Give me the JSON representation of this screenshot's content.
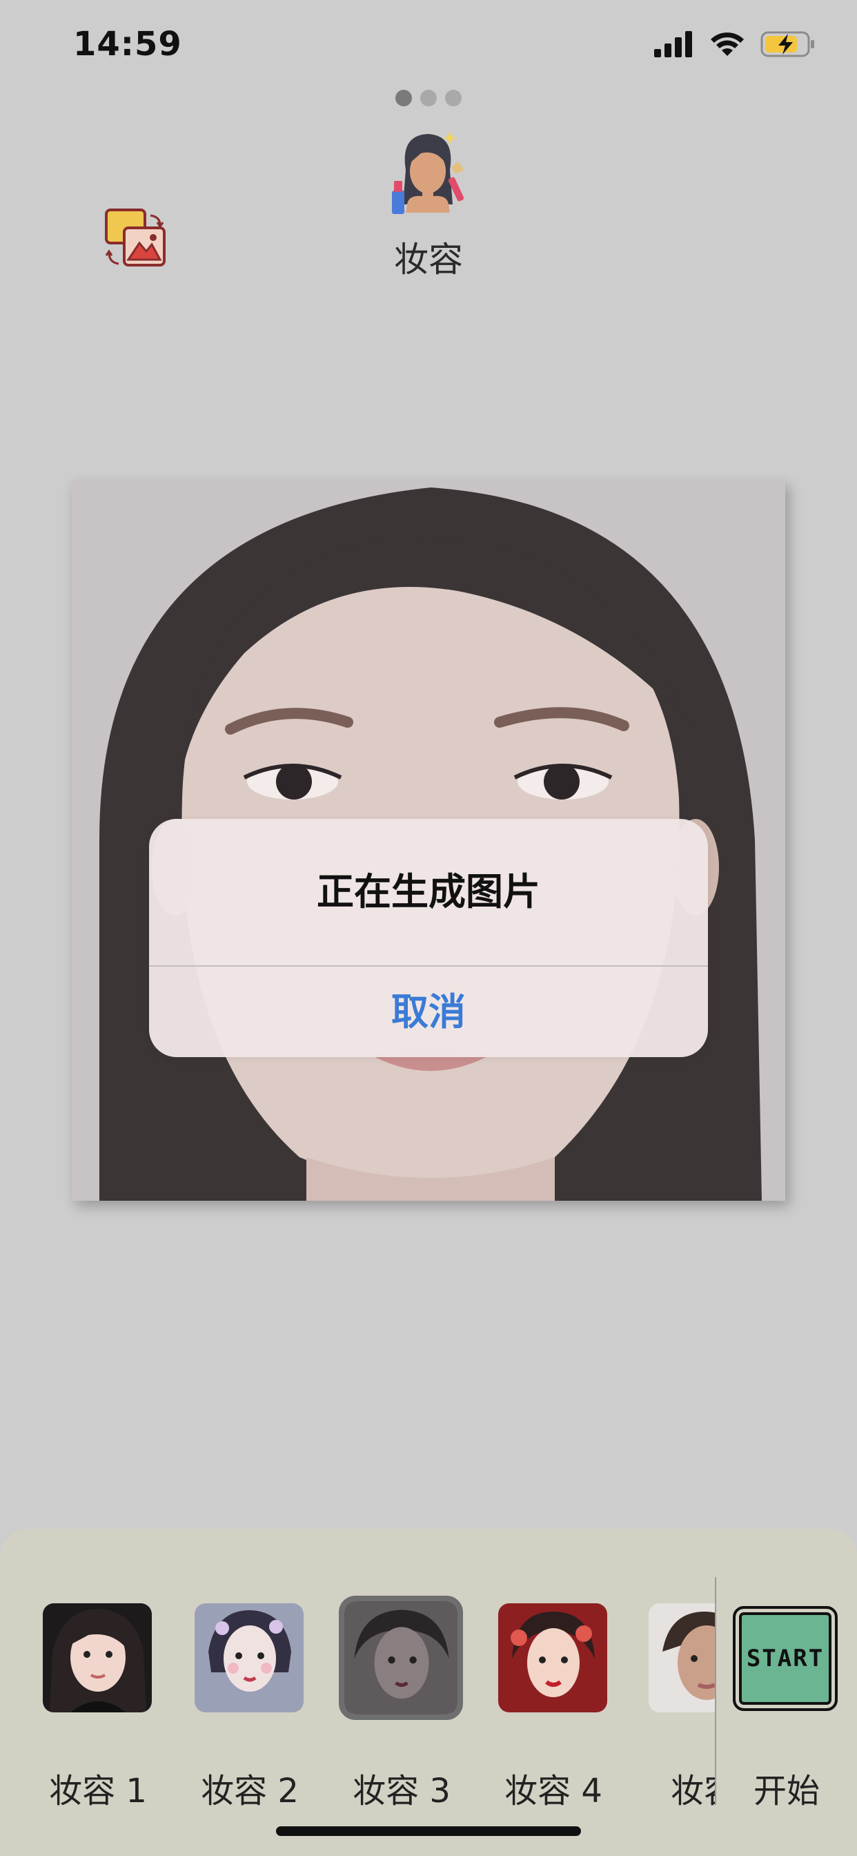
{
  "status_bar": {
    "time": "14:59"
  },
  "pager": {
    "active_index": 0,
    "count": 3
  },
  "header": {
    "title": "妆容",
    "icon": "makeup-girl-icon",
    "left_icon": "gallery-swap-icon"
  },
  "photo": {
    "description": "face-photo"
  },
  "alert": {
    "title": "正在生成图片",
    "cancel_label": "取消"
  },
  "styles": {
    "items": [
      {
        "label": "妆容 1"
      },
      {
        "label": "妆容 2"
      },
      {
        "label": "妆容 3",
        "selected": true
      },
      {
        "label": "妆容 4"
      },
      {
        "label": "妆容"
      }
    ]
  },
  "start": {
    "button_text": "START",
    "label": "开始",
    "color": "#6bb592"
  },
  "colors": {
    "accent": "#3a7bd5",
    "background": "#cdcdcd",
    "tray": "#d2d1c4"
  }
}
